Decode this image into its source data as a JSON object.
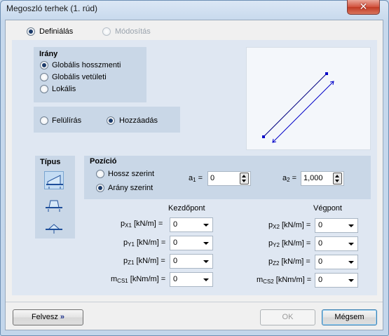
{
  "window": {
    "title": "Megoszló terhek (1. rúd)",
    "close_glyph": "✕"
  },
  "mode": {
    "define_label": "Definiálás",
    "modify_label": "Módosítás"
  },
  "direction": {
    "title": "Irány",
    "options": [
      "Globális hosszmenti",
      "Globális vetületi",
      "Lokális"
    ],
    "selected": "Globális hosszmenti"
  },
  "apply": {
    "options": [
      "Felülírás",
      "Hozzáadás"
    ],
    "selected": "Hozzáadás"
  },
  "type": {
    "title": "Típus",
    "icons": [
      "trapezoid-load-icon",
      "partial-load-icon",
      "triangle-load-icon"
    ]
  },
  "position": {
    "title": "Pozíció",
    "options": [
      "Hossz szerint",
      "Arány szerint"
    ],
    "selected": "Arány szerint",
    "a1": {
      "label": "a",
      "sub": "1",
      "eq": "=",
      "value": "0"
    },
    "a2": {
      "label": "a",
      "sub": "2",
      "eq": "=",
      "value": "1,000"
    }
  },
  "loads": {
    "start_header": "Kezdőpont",
    "end_header": "Végpont",
    "start": [
      {
        "sym": "p",
        "sub": "X1",
        "unit": "[kN/m] =",
        "value": "0"
      },
      {
        "sym": "p",
        "sub": "Y1",
        "unit": "[kN/m] =",
        "value": "0"
      },
      {
        "sym": "p",
        "sub": "Z1",
        "unit": "[kN/m] =",
        "value": "0"
      },
      {
        "sym": "m",
        "sub": "CS1",
        "unit": "[kNm/m] =",
        "value": "0"
      }
    ],
    "end": [
      {
        "sym": "p",
        "sub": "X2",
        "unit": "[kN/m] =",
        "value": "0"
      },
      {
        "sym": "p",
        "sub": "Y2",
        "unit": "[kN/m] =",
        "value": "0"
      },
      {
        "sym": "p",
        "sub": "Z2",
        "unit": "[kN/m] =",
        "value": "0"
      },
      {
        "sym": "m",
        "sub": "CS2",
        "unit": "[kNm/m] =",
        "value": "0"
      }
    ]
  },
  "buttons": {
    "felvesz": "Felvesz",
    "felvesz_glyph": "»",
    "ok": "OK",
    "cancel": "Mégsem"
  },
  "colors": {
    "accent": "#1c3b6a",
    "preview_line": "#000080"
  }
}
